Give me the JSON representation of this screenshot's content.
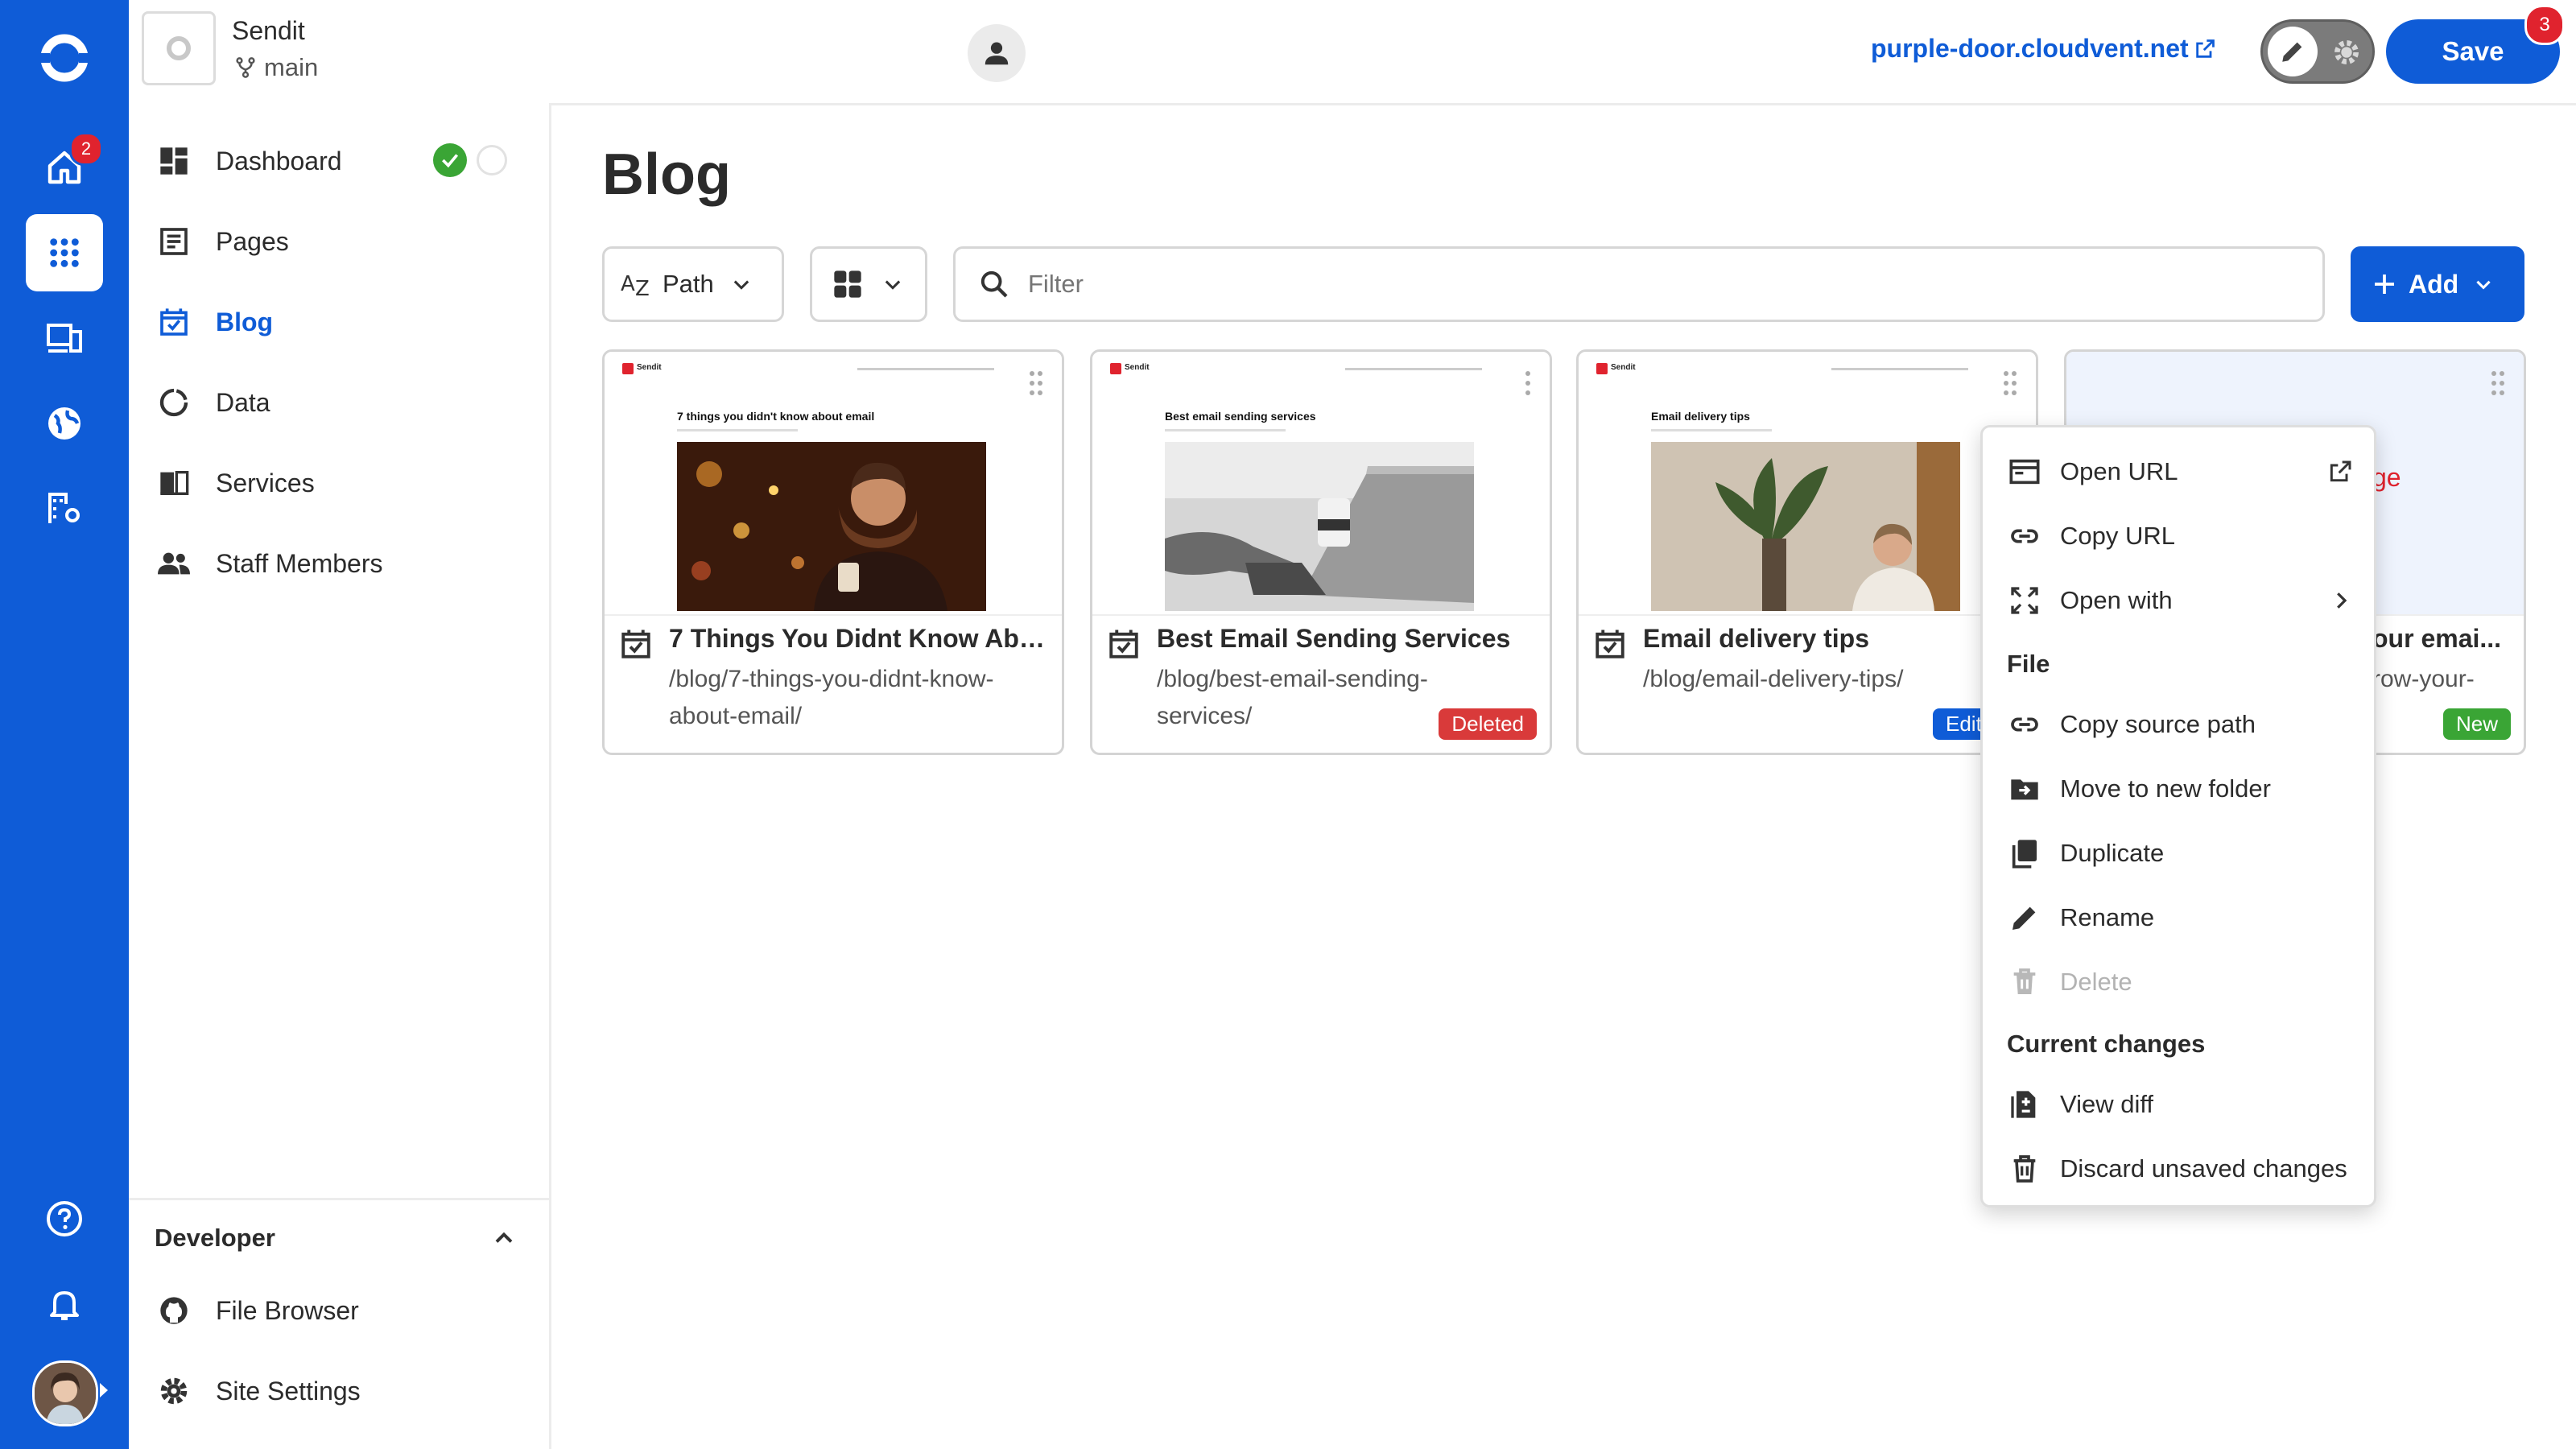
{
  "colors": {
    "brand": "#0f5cd7",
    "danger": "#d93a3a",
    "success": "#3aa535",
    "badge_red": "#e0232e"
  },
  "rail": {
    "home_badge": "2"
  },
  "header": {
    "project_name": "Sendit",
    "branch": "main",
    "site_url": "purple-door.cloudvent.net",
    "save_label": "Save",
    "save_badge": "3"
  },
  "sidebar": {
    "items": [
      {
        "label": "Dashboard",
        "icon": "dashboard-icon"
      },
      {
        "label": "Pages",
        "icon": "pages-icon"
      },
      {
        "label": "Blog",
        "icon": "calendar-check-icon"
      },
      {
        "label": "Data",
        "icon": "data-icon"
      },
      {
        "label": "Services",
        "icon": "services-icon"
      },
      {
        "label": "Staff Members",
        "icon": "people-icon"
      }
    ],
    "developer": {
      "heading": "Developer",
      "items": [
        {
          "label": "File Browser",
          "icon": "github-icon"
        },
        {
          "label": "Site Settings",
          "icon": "gear-icon"
        }
      ]
    }
  },
  "main": {
    "title": "Blog",
    "sort_label": "Path",
    "filter_placeholder": "Filter",
    "add_label": "Add"
  },
  "cards": [
    {
      "title": "7 Things You Didnt Know Abo...",
      "path": "/blog/7-things-you-didnt-know-about-email/",
      "badge": "",
      "thumb_title": "7 things you didn't know about email",
      "thumb_brand": "Sendit"
    },
    {
      "title": "Best Email Sending Services",
      "path": "/blog/best-email-sending-services/",
      "badge": "Deleted",
      "thumb_title": "Best email sending services",
      "thumb_brand": "Sendit"
    },
    {
      "title": "Email delivery tips",
      "path": "/blog/email-delivery-tips/",
      "badge": "Edit",
      "thumb_title": "Email delivery tips",
      "thumb_brand": "Sendit"
    },
    {
      "title": "our emai...",
      "path": "row-your-",
      "badge": "New",
      "thumb_text": "ge"
    }
  ],
  "context_menu": {
    "top_items": [
      {
        "label": "Open URL",
        "icon": "open-url-icon"
      },
      {
        "label": "Copy URL",
        "icon": "link-icon"
      },
      {
        "label": "Open with",
        "icon": "expand-icon"
      }
    ],
    "file_heading": "File",
    "file_items": [
      {
        "label": "Copy source path",
        "icon": "link-icon"
      },
      {
        "label": "Move to new folder",
        "icon": "move-folder-icon"
      },
      {
        "label": "Duplicate",
        "icon": "duplicate-icon"
      },
      {
        "label": "Rename",
        "icon": "pencil-icon"
      },
      {
        "label": "Delete",
        "icon": "trash-icon"
      }
    ],
    "changes_heading": "Current changes",
    "changes_items": [
      {
        "label": "View diff",
        "icon": "diff-icon"
      },
      {
        "label": "Discard unsaved changes",
        "icon": "trash-icon"
      }
    ]
  }
}
